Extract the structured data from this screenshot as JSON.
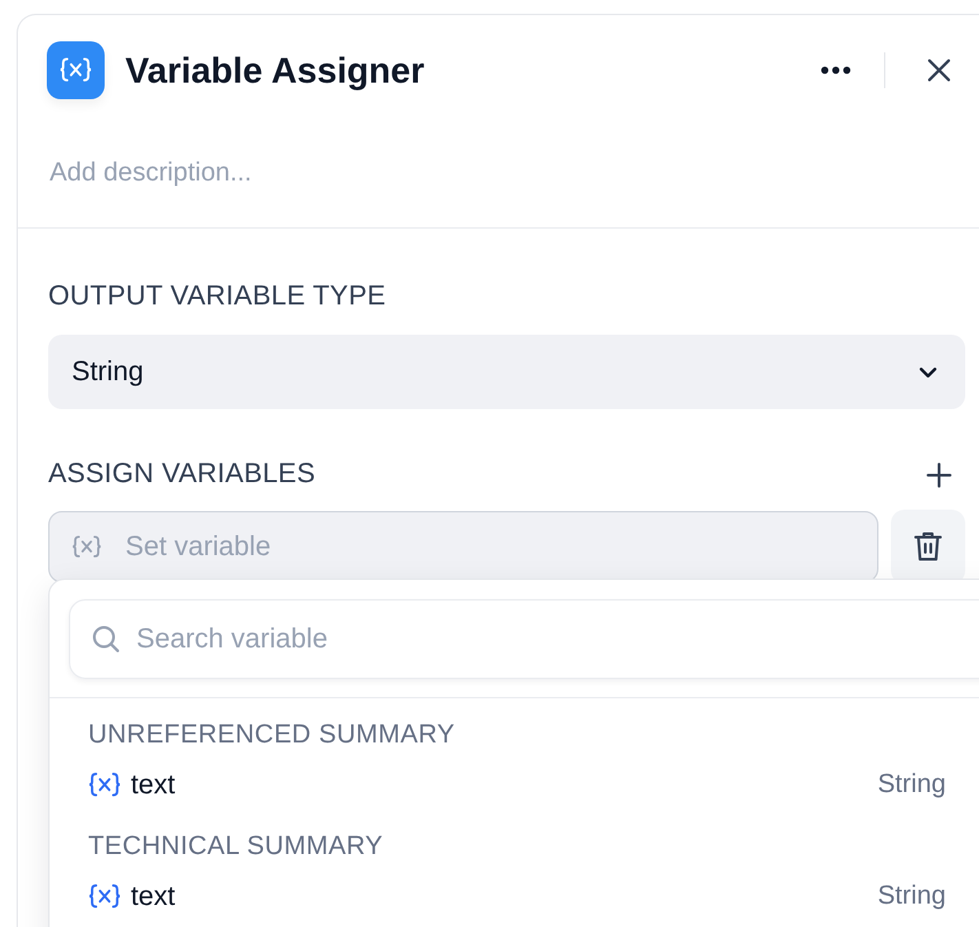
{
  "panel": {
    "title": "Variable Assigner",
    "description_placeholder": "Add description..."
  },
  "output_type": {
    "label": "OUTPUT VARIABLE TYPE",
    "value": "String"
  },
  "assign": {
    "label": "ASSIGN VARIABLES",
    "placeholder": "Set variable",
    "expanded": true
  },
  "picker": {
    "search_placeholder": "Search variable",
    "groups": [
      {
        "title": "UNREFERENCED SUMMARY",
        "items": [
          {
            "name": "text",
            "type": "String"
          }
        ]
      },
      {
        "title": "TECHNICAL SUMMARY",
        "items": [
          {
            "name": "text",
            "type": "String"
          }
        ]
      }
    ]
  }
}
